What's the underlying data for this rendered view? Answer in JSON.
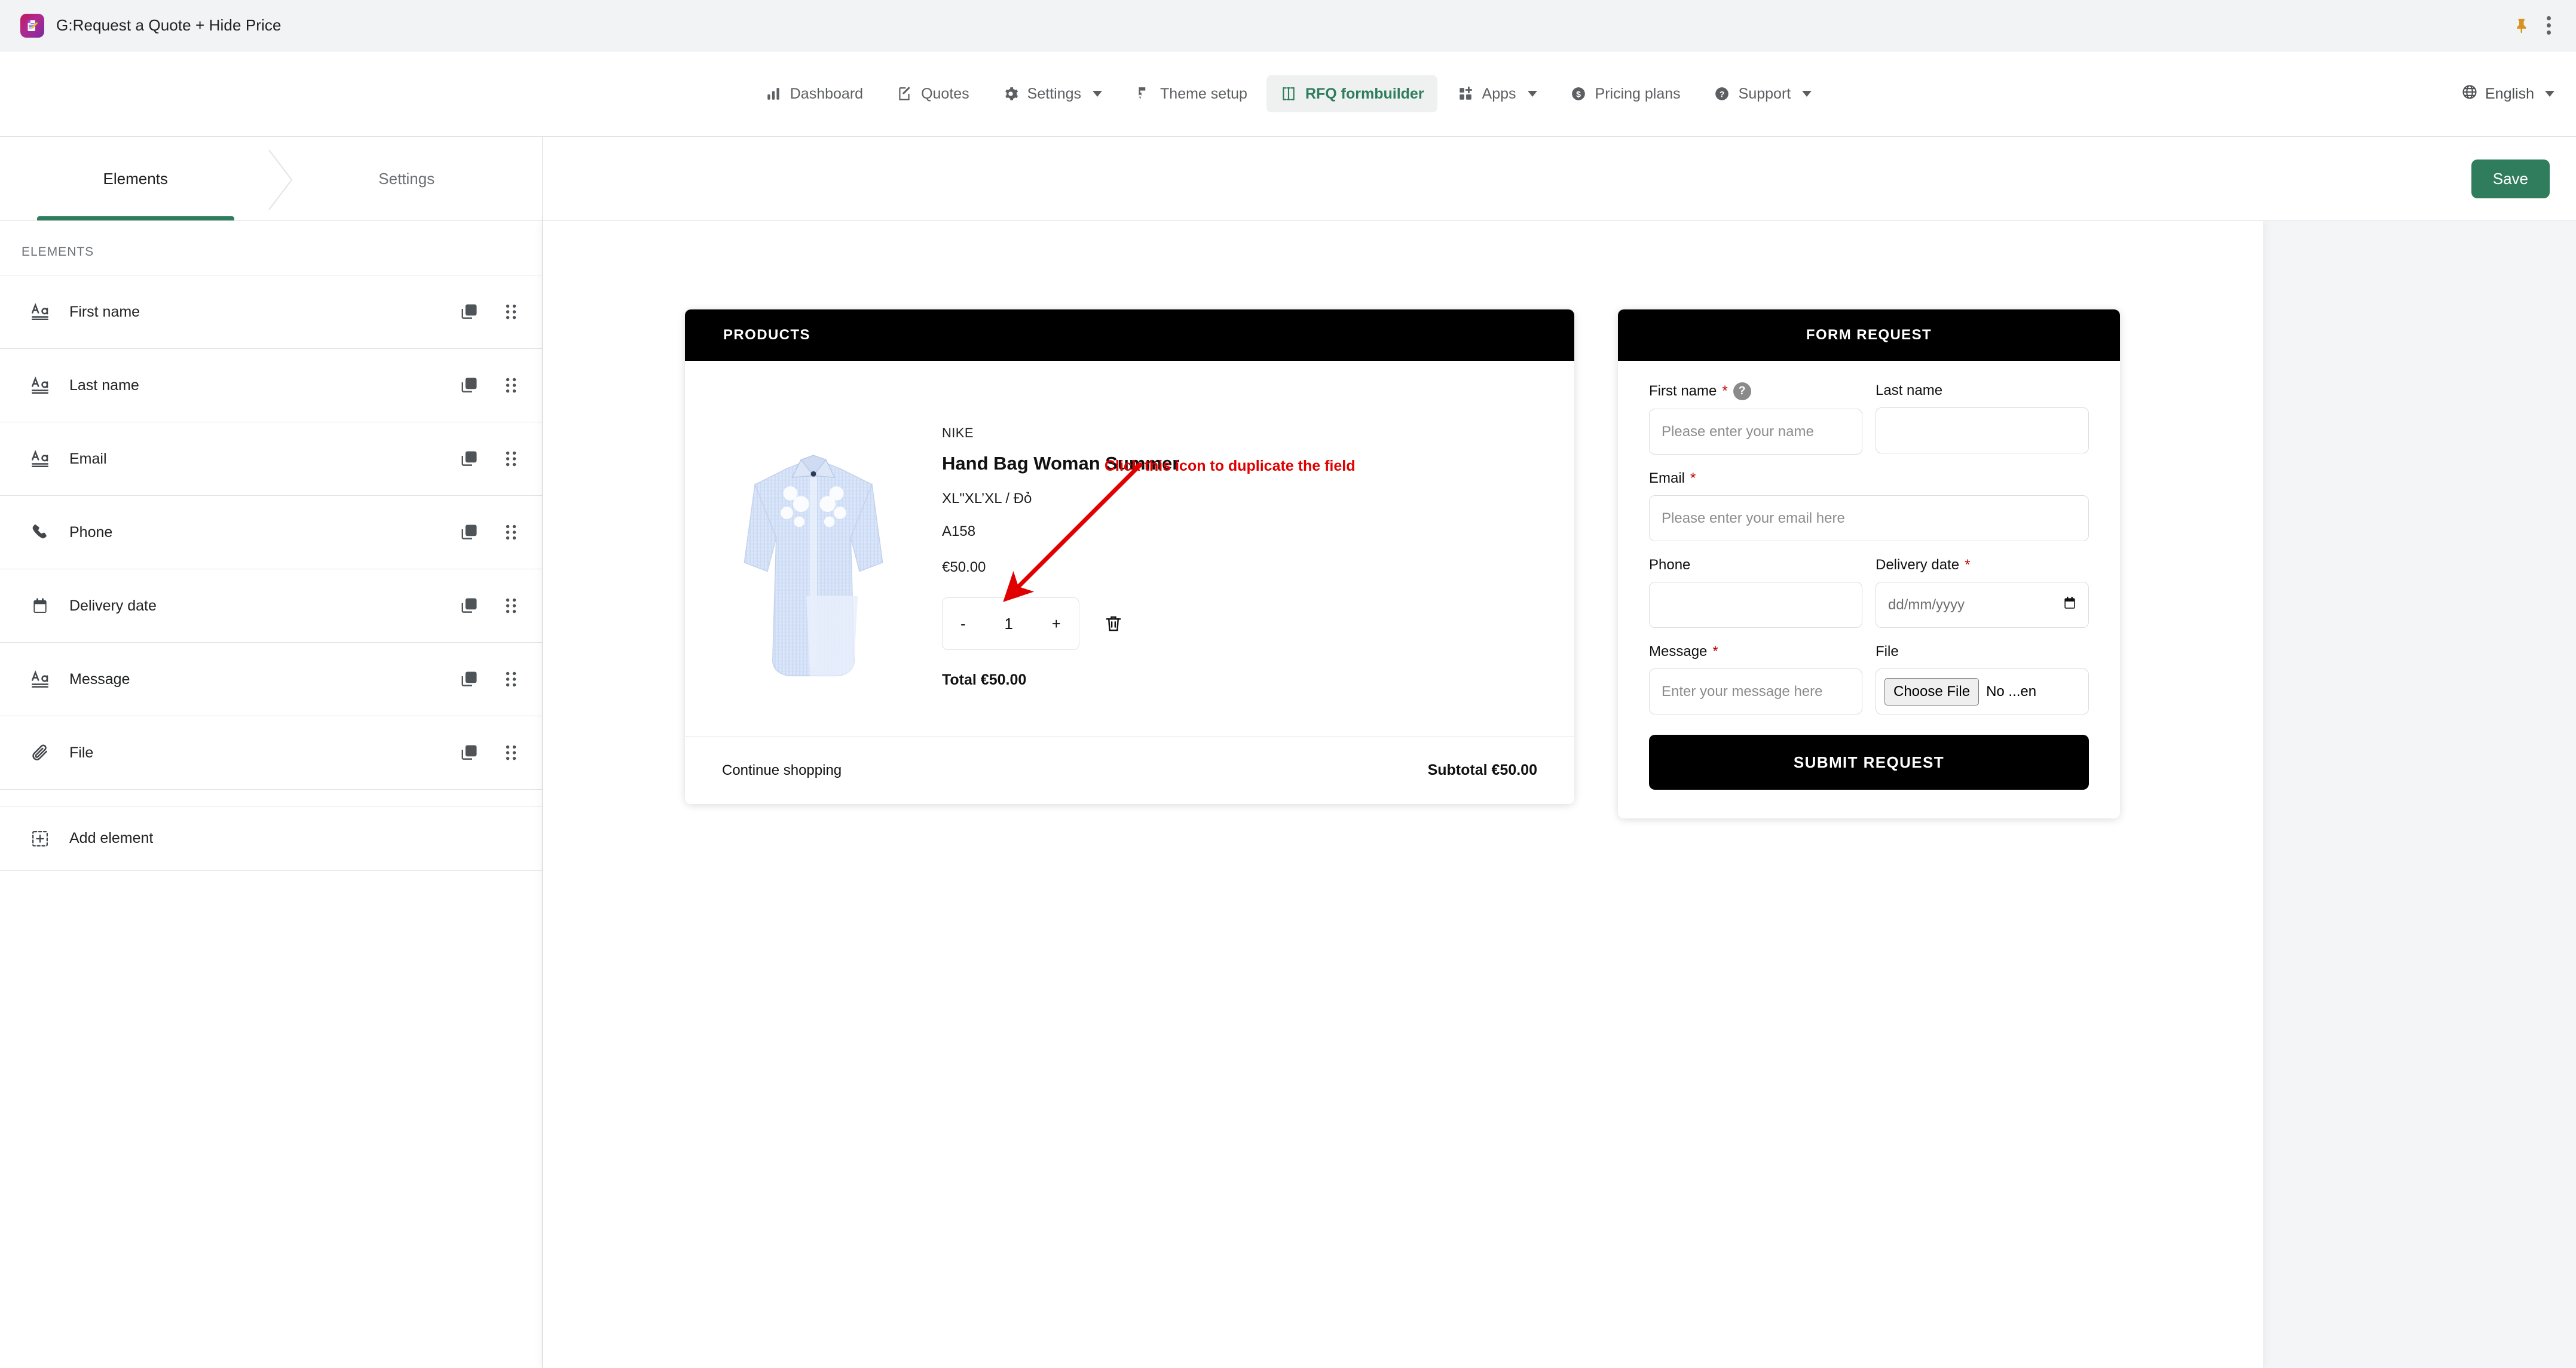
{
  "chrome": {
    "title": "G:Request a Quote + Hide Price",
    "app_icon": "document-pencil-icon",
    "pin_icon": "pin-icon",
    "menu_icon": "browser-menu-icon"
  },
  "nav": {
    "items": [
      {
        "label": "Dashboard",
        "icon": "bar-chart-icon",
        "active": false,
        "has_caret": false
      },
      {
        "label": "Quotes",
        "icon": "edit-note-icon",
        "active": false,
        "has_caret": false
      },
      {
        "label": "Settings",
        "icon": "gear-icon",
        "active": false,
        "has_caret": true
      },
      {
        "label": "Theme setup",
        "icon": "paint-theme-icon",
        "active": false,
        "has_caret": false
      },
      {
        "label": "RFQ formbuilder",
        "icon": "formbuilder-icon",
        "active": true,
        "has_caret": false
      },
      {
        "label": "Apps",
        "icon": "apps-grid-icon",
        "active": false,
        "has_caret": true
      },
      {
        "label": "Pricing plans",
        "icon": "dollar-coin-icon",
        "active": false,
        "has_caret": false
      },
      {
        "label": "Support",
        "icon": "question-circle-icon",
        "active": false,
        "has_caret": true
      }
    ],
    "language": {
      "label": "English",
      "icon": "globe-icon"
    },
    "accent_color": "#2f7d5d"
  },
  "sidebar": {
    "tabs": [
      {
        "label": "Elements",
        "active": true
      },
      {
        "label": "Settings",
        "active": false
      }
    ],
    "section_label": "ELEMENTS",
    "elements": [
      {
        "label": "First name",
        "icon": "text-field-icon"
      },
      {
        "label": "Last name",
        "icon": "text-field-icon"
      },
      {
        "label": "Email",
        "icon": "text-field-icon"
      },
      {
        "label": "Phone",
        "icon": "phone-icon"
      },
      {
        "label": "Delivery date",
        "icon": "calendar-icon"
      },
      {
        "label": "Message",
        "icon": "text-field-icon"
      },
      {
        "label": "File",
        "icon": "paperclip-icon"
      }
    ],
    "row_actions": {
      "duplicate_icon": "duplicate-icon",
      "drag_icon": "drag-handle-icon"
    },
    "add_element": {
      "label": "Add element",
      "icon": "add-element-icon"
    }
  },
  "annotation": {
    "text": "Click this icon to duplicate the field",
    "color": "#e00000"
  },
  "editor": {
    "save_label": "Save"
  },
  "preview": {
    "products_card": {
      "header": "PRODUCTS",
      "product": {
        "vendor": "NIKE",
        "title": "Hand Bag Woman Summer",
        "variant": "XL\"XL’XL / Đỏ",
        "sku": "A158",
        "price": "€50.00",
        "quantity": "1",
        "decrement_label": "-",
        "increment_label": "+",
        "delete_icon": "trash-icon",
        "total_label": "Total €50.00",
        "image_alt": "light blue striped shirt dress"
      },
      "footer": {
        "continue_label": "Continue shopping",
        "subtotal_label": "Subtotal €50.00"
      }
    },
    "form_card": {
      "header": "FORM REQUEST",
      "fields": {
        "first_name": {
          "label": "First name",
          "required": "*",
          "placeholder": "Please enter your name",
          "value": "",
          "help_icon": "question-circle-icon"
        },
        "last_name": {
          "label": "Last name",
          "required": "",
          "placeholder": "",
          "value": ""
        },
        "email": {
          "label": "Email",
          "required": "*",
          "placeholder": "Please enter your email here",
          "value": ""
        },
        "phone": {
          "label": "Phone",
          "required": "",
          "placeholder": "",
          "value": ""
        },
        "delivery_date": {
          "label": "Delivery date",
          "required": "*",
          "placeholder": "dd/mm/yyyy",
          "value": "",
          "icon": "calendar-icon"
        },
        "message": {
          "label": "Message",
          "required": "*",
          "placeholder": "Enter your message here",
          "value": ""
        },
        "file": {
          "label": "File",
          "required": "",
          "button_label": "Choose File",
          "status_text": "No ...en"
        }
      },
      "submit_label": "SUBMIT REQUEST"
    }
  }
}
